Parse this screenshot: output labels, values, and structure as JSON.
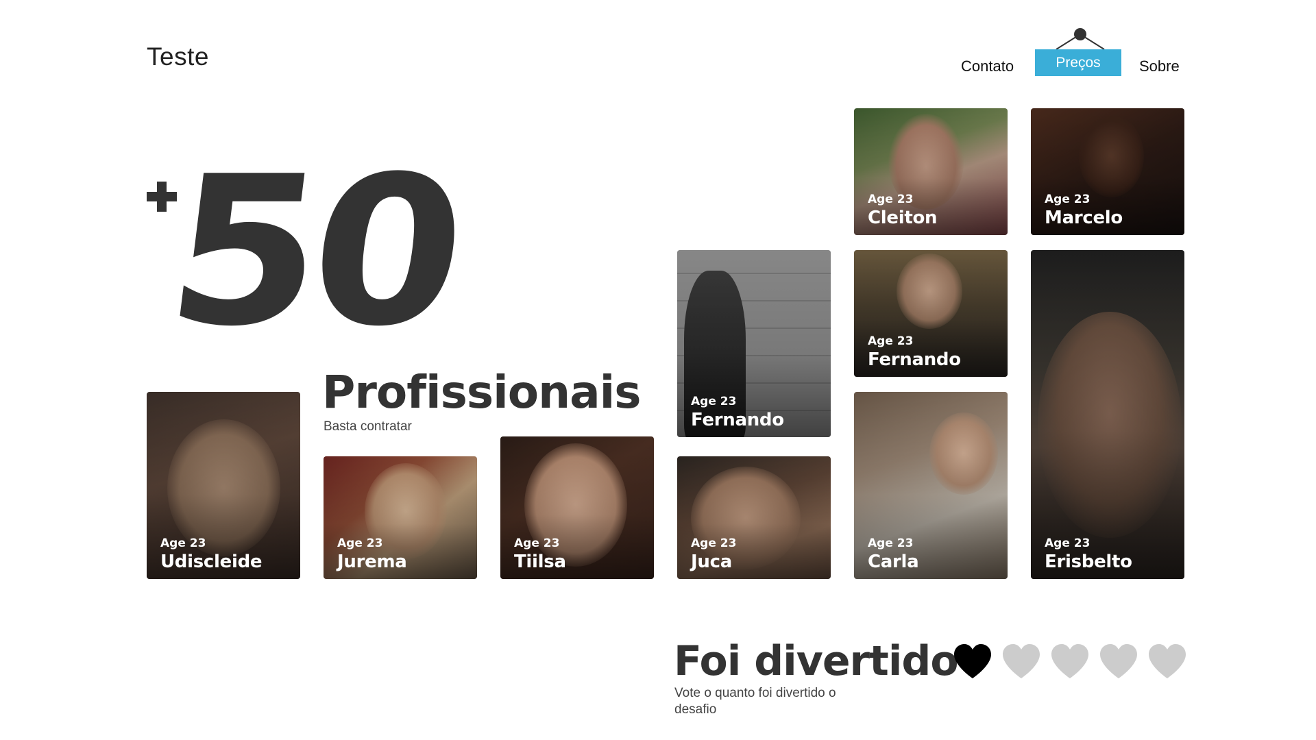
{
  "header": {
    "brand": "Teste",
    "nav": {
      "contato": "Contato",
      "precos": "Preços",
      "sobre": "Sobre"
    }
  },
  "hero": {
    "plus": "+",
    "number": "50",
    "title": "Profissionais",
    "subtitle": "Basta contratar"
  },
  "cards": [
    {
      "age": "Age 23",
      "name": "Cleiton"
    },
    {
      "age": "Age 23",
      "name": "Marcelo"
    },
    {
      "age": "Age 23",
      "name": "Fernando"
    },
    {
      "age": "Age 23",
      "name": "Fernando"
    },
    {
      "age": "Age 23",
      "name": "Erisbelto"
    },
    {
      "age": "Age 23",
      "name": "Udiscleide"
    },
    {
      "age": "Age 23",
      "name": "Jurema"
    },
    {
      "age": "Age 23",
      "name": "Tiilsa"
    },
    {
      "age": "Age 23",
      "name": "Juca"
    },
    {
      "age": "Age 23",
      "name": "Carla"
    }
  ],
  "rating": {
    "title": "Foi divertido",
    "subtitle": "Vote o quanto foi divertido o desafio",
    "value": 1,
    "max": 5
  },
  "colors": {
    "accent": "#3aaed8",
    "heart_active": "#000000",
    "heart_inactive": "#cccccc",
    "text": "#333333"
  }
}
